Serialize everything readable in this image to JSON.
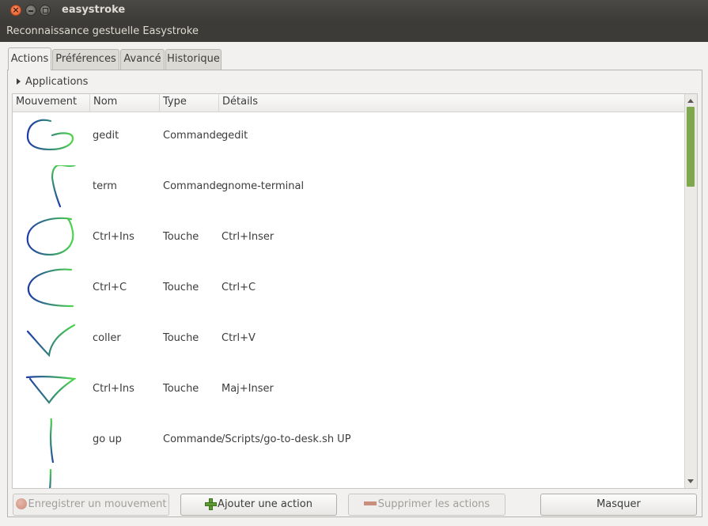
{
  "window": {
    "title": "easystroke",
    "subtitle": "Reconnaissance gestuelle Easystroke",
    "close_glyph": "×"
  },
  "tabs": [
    {
      "label": "Actions",
      "active": true
    },
    {
      "label": "Préférences",
      "active": false
    },
    {
      "label": "Avancé",
      "active": false
    },
    {
      "label": "Historique",
      "active": false
    }
  ],
  "expander": {
    "label": "Applications",
    "icon": "triangle-right-icon"
  },
  "columns": [
    "Mouvement",
    "Nom",
    "Type",
    "Détails"
  ],
  "rows": [
    {
      "name": "gedit",
      "type": "Commande",
      "details": "gedit",
      "stroke": "stroke-g-icon"
    },
    {
      "name": "term",
      "type": "Commande",
      "details": "gnome-terminal",
      "stroke": "stroke-t-icon"
    },
    {
      "name": "Ctrl+Ins",
      "type": "Touche",
      "details": "Ctrl+Inser",
      "stroke": "stroke-o-icon"
    },
    {
      "name": "Ctrl+C",
      "type": "Touche",
      "details": "Ctrl+C",
      "stroke": "stroke-c-icon"
    },
    {
      "name": "coller",
      "type": "Touche",
      "details": "Ctrl+V",
      "stroke": "stroke-v-icon"
    },
    {
      "name": "Ctrl+Ins",
      "type": "Touche",
      "details": "Maj+Inser",
      "stroke": "stroke-triangle-icon"
    },
    {
      "name": "go up",
      "type": "Commande",
      "details": "/Scripts/go-to-desk.sh UP",
      "stroke": "stroke-line-up-icon"
    },
    {
      "name": "",
      "type": "",
      "details": "",
      "stroke": "stroke-line-down-icon"
    }
  ],
  "buttons": {
    "record": "Enregistrer un mouvement",
    "add": "Ajouter une action",
    "delete": "Supprimer les actions",
    "hide": "Masquer"
  },
  "colors": {
    "stroke_start": "#1e3aa8",
    "stroke_end": "#4ed64a",
    "scroll_thumb": "#7fa84e"
  }
}
